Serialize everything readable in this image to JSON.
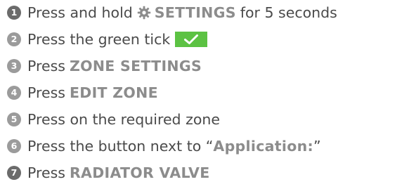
{
  "steps": [
    {
      "number": "1",
      "parts": {
        "pre": "Press and hold",
        "keyword": "SETTINGS",
        "post": "for 5 seconds"
      },
      "icon": "gear-icon"
    },
    {
      "number": "2",
      "parts": {
        "pre": "Press the green tick"
      },
      "icon": "green-tick-button-icon"
    },
    {
      "number": "3",
      "parts": {
        "pre": "Press",
        "keyword": "ZONE SETTINGS"
      }
    },
    {
      "number": "4",
      "parts": {
        "pre": "Press",
        "keyword": "EDIT ZONE"
      }
    },
    {
      "number": "5",
      "parts": {
        "pre": "Press on the required zone"
      }
    },
    {
      "number": "6",
      "parts": {
        "pre": "Press the button next to “",
        "keyword": "Application:",
        "post": "”"
      }
    },
    {
      "number": "7",
      "parts": {
        "pre": "Press",
        "keyword": "RADIATOR VALVE"
      }
    }
  ],
  "colors": {
    "text": "#4a4a4a",
    "keyword": "#8c8c8c",
    "number_badge": "#9b9b9b",
    "tick_green": "#5cc243"
  }
}
